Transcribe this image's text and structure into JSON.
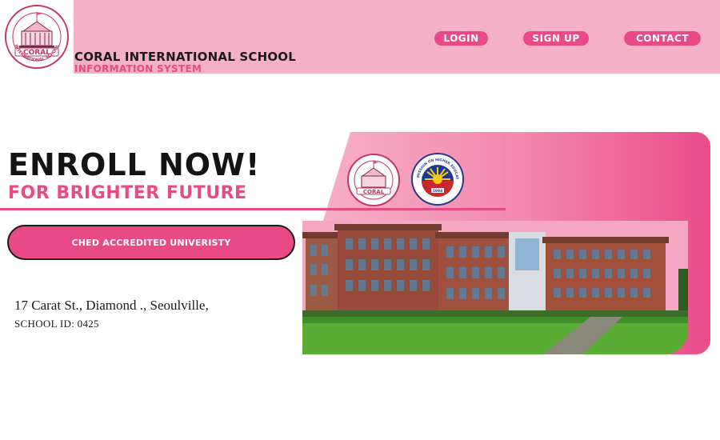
{
  "header": {
    "school_name": "CORAL INTERNATIONAL SCHOOL",
    "subtitle": "INFORMATION SYSTEM",
    "nav": {
      "login": "LOGIN",
      "signup": "SIGN UP",
      "contact": "CONTACT"
    },
    "logo": {
      "name": "CORAL",
      "ring_text": "INTERNATIONAL SCHOOL"
    }
  },
  "hero": {
    "headline": "ENROLL NOW!",
    "subheadline": "FOR BRIGHTER FUTURE",
    "accreditation_button": "CHED ACCREDITED UNIVERISTY",
    "address": "17 Carat St., Diamond ., Seoulville,",
    "school_id": "SCHOOL ID: 0425",
    "ched_seal": {
      "ring_text": "COMMISSION ON HIGHER EDUCATION",
      "year": "1994"
    }
  },
  "colors": {
    "accent": "#e94a86",
    "header_bg": "#f4b0c6",
    "text": "#1a1a1a"
  }
}
